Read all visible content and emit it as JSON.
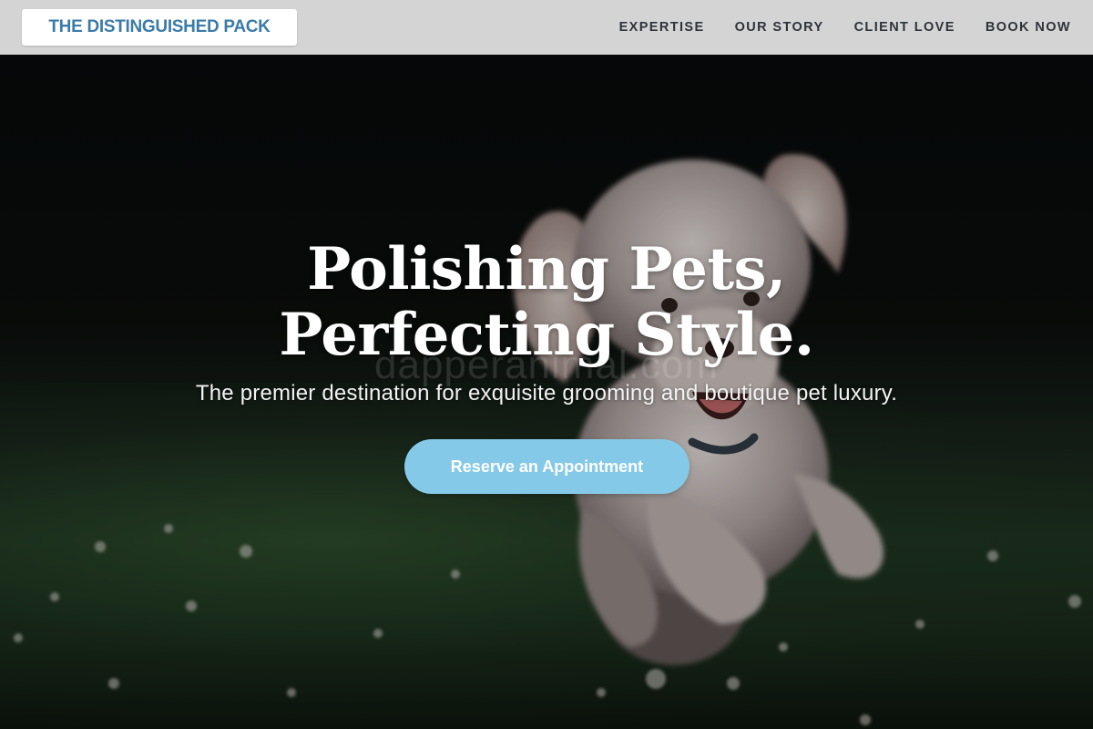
{
  "header": {
    "logo_text": "THE DISTINGUISHED PACK",
    "nav": [
      {
        "label": "EXPERTISE"
      },
      {
        "label": "OUR STORY"
      },
      {
        "label": "CLIENT LOVE"
      },
      {
        "label": "BOOK NOW"
      }
    ]
  },
  "hero": {
    "headline_line1": "Polishing Pets,",
    "headline_line2": "Perfecting Style.",
    "watermark": "dapperanimal.com",
    "subtitle": "The premier destination for exquisite grooming and boutique pet luxury.",
    "cta_label": "Reserve an Appointment",
    "background_image": "fluffy-dog-running-on-grass-photo"
  },
  "colors": {
    "header_bg": "#d4d4d4",
    "logo_text": "#3b7ba8",
    "nav_text": "#2e333a",
    "cta_bg": "#85c9e8",
    "headline": "#ffffff"
  }
}
